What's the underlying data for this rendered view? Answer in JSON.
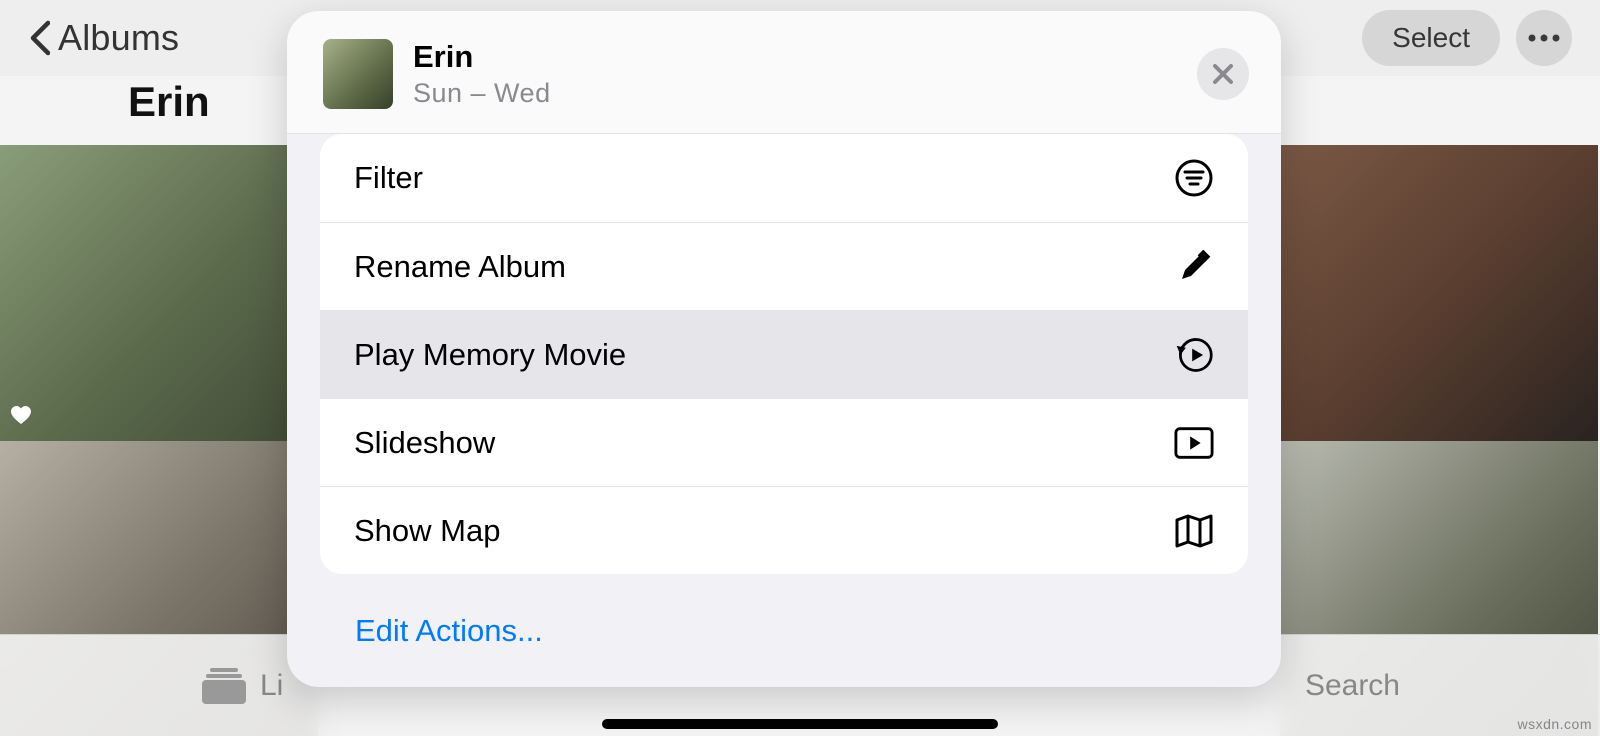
{
  "nav": {
    "back_label": "Albums",
    "select_label": "Select"
  },
  "album": {
    "title": "Erin"
  },
  "sheet": {
    "title": "Erin",
    "subtitle": "Sun – Wed",
    "menu": {
      "filter": "Filter",
      "rename": "Rename Album",
      "play_memory": "Play Memory Movie",
      "slideshow": "Slideshow",
      "show_map": "Show Map"
    },
    "edit_actions": "Edit Actions..."
  },
  "tabbar": {
    "library": "Li",
    "search": "Search"
  },
  "attribution": "wsxdn.com"
}
